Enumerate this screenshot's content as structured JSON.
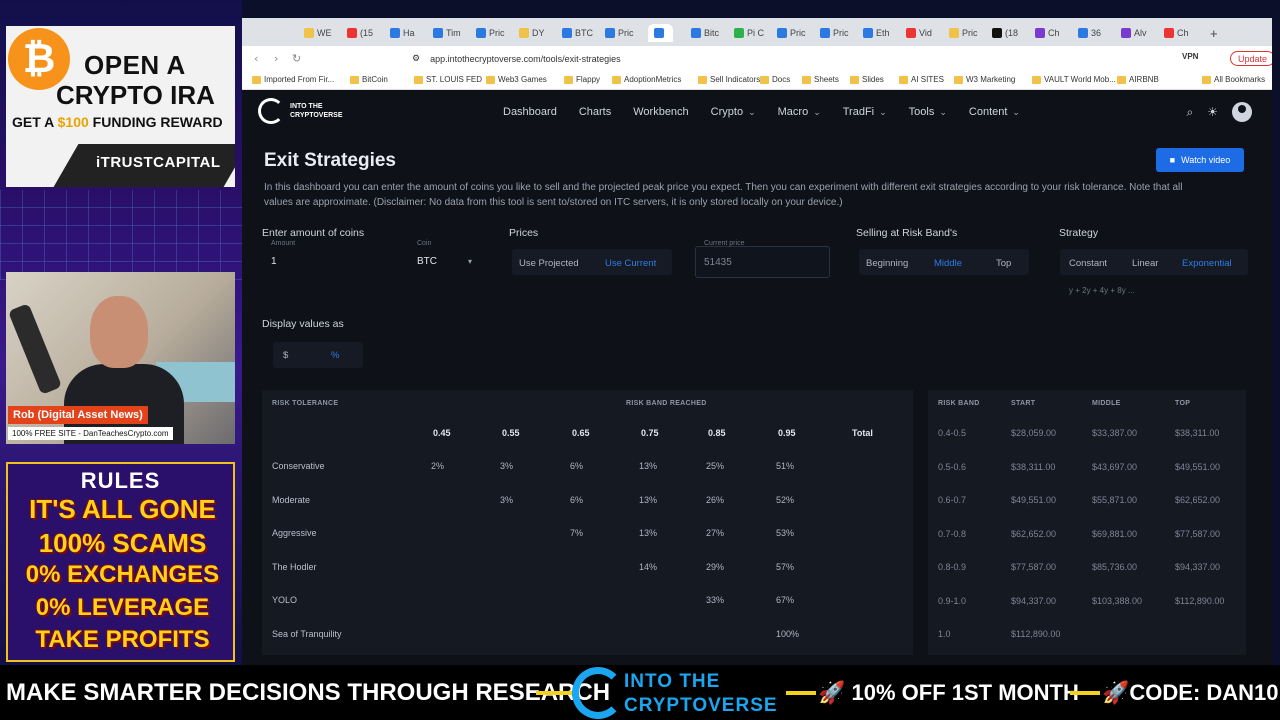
{
  "ad": {
    "line1": "OPEN A",
    "line2": "CRYPTO IRA",
    "line3_pre": "GET A ",
    "line3_amount": "$100",
    "line3_post": " FUNDING REWARD",
    "brand": "iTRUSTCAPITAL",
    "coin_symbol": "₿"
  },
  "cam": {
    "name": "Rob (Digital Asset News)",
    "site": "100% FREE SITE - DanTeachesCrypto.com"
  },
  "rules": {
    "title": "RULES",
    "lines": [
      "IT'S ALL GONE",
      "100% SCAMS",
      "0% EXCHANGES",
      "0% LEVERAGE",
      "TAKE PROFITS"
    ]
  },
  "browser": {
    "tabs": [
      "WE",
      "(15",
      "Ha",
      "Tim",
      "Pric",
      "DY",
      "BTC",
      "Pric",
      "",
      "Bitc",
      "Pi C",
      "Pric",
      "Pric",
      "Eth",
      "Vid",
      "Pric",
      "(18",
      "Ch",
      "36",
      "Alv",
      "Ch"
    ],
    "url": "app.intothecryptoverse.com/tools/exit-strategies",
    "update_label": "Update",
    "vpn_label": "VPN",
    "bookmarks": [
      "Imported From Fir...",
      "BitCoin",
      "ST. LOUIS FED",
      "Web3 Games",
      "Flappy",
      "AdoptionMetrics",
      "Sell Indicators",
      "Docs",
      "Sheets",
      "Slides",
      "AI SITES",
      "W3 Marketing",
      "VAULT World Mob...",
      "AIRBNB",
      "All Bookmarks"
    ]
  },
  "app": {
    "logo_text": "INTO THE CRYPTOVERSE",
    "nav": [
      {
        "label": "Dashboard",
        "dropdown": false
      },
      {
        "label": "Charts",
        "dropdown": false
      },
      {
        "label": "Workbench",
        "dropdown": false
      },
      {
        "label": "Crypto",
        "dropdown": true
      },
      {
        "label": "Macro",
        "dropdown": true
      },
      {
        "label": "TradFi",
        "dropdown": true
      },
      {
        "label": "Tools",
        "dropdown": true
      },
      {
        "label": "Content",
        "dropdown": true
      }
    ],
    "title": "Exit Strategies",
    "watch_video": "Watch video",
    "description": "In this dashboard you can enter the amount of coins you like to sell and the projected peak price you expect. Then you can experiment with different exit strategies according to your risk tolerance. Note that all values are approximate. (Disclaimer: No data from this tool is sent to/stored on ITC servers, it is only stored locally on your device.)",
    "coins": {
      "section_label": "Enter amount of coins",
      "amount_label": "Amount",
      "amount_value": "1",
      "coin_label": "Coin",
      "coin_value": "BTC"
    },
    "prices": {
      "section_label": "Prices",
      "use_projected": "Use Projected",
      "use_current": "Use Current",
      "current_price_label": "Current price",
      "current_price_value": "51435"
    },
    "selling": {
      "section_label": "Selling at Risk Band's",
      "options": [
        "Beginning",
        "Middle",
        "Top"
      ],
      "active": "Middle"
    },
    "strategy": {
      "section_label": "Strategy",
      "options": [
        "Constant",
        "Linear",
        "Exponential"
      ],
      "active": "Exponential",
      "formula": "y + 2y + 4y + 8y ..."
    },
    "display": {
      "section_label": "Display values as",
      "options": [
        "$",
        "%"
      ],
      "active": "%"
    },
    "risk_table": {
      "header_left": "RISK TOLERANCE",
      "header_right": "RISK BAND REACHED",
      "columns": [
        "0.45",
        "0.55",
        "0.65",
        "0.75",
        "0.85",
        "0.95",
        "Total"
      ],
      "rows": [
        {
          "name": "Conservative",
          "cells": [
            "2%",
            "3%",
            "6%",
            "13%",
            "25%",
            "51%",
            ""
          ]
        },
        {
          "name": "Moderate",
          "cells": [
            "",
            "3%",
            "6%",
            "13%",
            "26%",
            "52%",
            ""
          ]
        },
        {
          "name": "Aggressive",
          "cells": [
            "",
            "",
            "7%",
            "13%",
            "27%",
            "53%",
            ""
          ]
        },
        {
          "name": "The Hodler",
          "cells": [
            "",
            "",
            "",
            "14%",
            "29%",
            "57%",
            ""
          ]
        },
        {
          "name": "YOLO",
          "cells": [
            "",
            "",
            "",
            "",
            "33%",
            "67%",
            ""
          ]
        },
        {
          "name": "Sea of Tranquility",
          "cells": [
            "",
            "",
            "",
            "",
            "",
            "100%",
            ""
          ]
        }
      ]
    },
    "band_table": {
      "headers": [
        "RISK BAND",
        "START",
        "MIDDLE",
        "TOP"
      ],
      "rows": [
        [
          "0.4-0.5",
          "$28,059.00",
          "$33,387.00",
          "$38,311.00"
        ],
        [
          "0.5-0.6",
          "$38,311.00",
          "$43,697.00",
          "$49,551.00"
        ],
        [
          "0.6-0.7",
          "$49,551.00",
          "$55,871.00",
          "$62,652.00"
        ],
        [
          "0.7-0.8",
          "$62,652.00",
          "$69,881.00",
          "$77,587.00"
        ],
        [
          "0.8-0.9",
          "$77,587.00",
          "$85,736.00",
          "$94,337.00"
        ],
        [
          "0.9-1.0",
          "$94,337.00",
          "$103,388.00",
          "$112,890.00"
        ],
        [
          "1.0",
          "$112,890.00",
          "",
          ""
        ]
      ]
    }
  },
  "ticker": {
    "part1": "MAKE SMARTER DECISIONS THROUGH RESEARCH",
    "logo_line1": "INTO THE",
    "logo_line2": "CRYPTOVERSE",
    "part2": "🚀 10% OFF 1ST MONTH",
    "part3": "🚀CODE: DAN10"
  },
  "colors": {
    "accent_blue": "#2f7de8",
    "button_blue": "#1d6ce6",
    "ticker_yellow": "#f2d21a",
    "logo_cyan": "#1aa6f0",
    "btc_orange": "#f7931a",
    "name_tag_red": "#e2431b"
  }
}
